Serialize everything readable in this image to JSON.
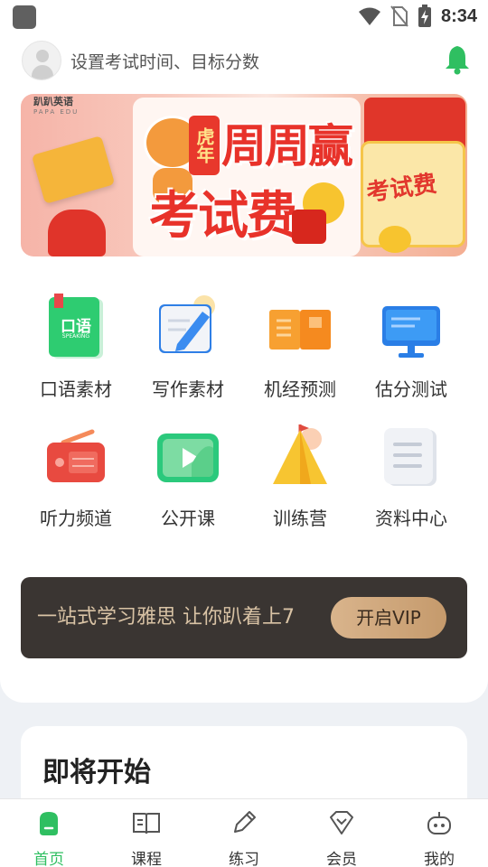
{
  "status_bar": {
    "time": "8:34"
  },
  "header": {
    "exam_prompt": "设置考试时间、目标分数"
  },
  "banner": {
    "logo_text": "趴趴英语",
    "logo_sub": "PAPA EDU",
    "tag": "虎年",
    "title_line1": "周周赢",
    "title_line2": "考试费",
    "side_text": "考试费"
  },
  "grid": {
    "items": [
      {
        "label": "口语素材",
        "icon": "speaking-book-icon"
      },
      {
        "label": "写作素材",
        "icon": "writing-pen-icon"
      },
      {
        "label": "机经预测",
        "icon": "open-book-icon"
      },
      {
        "label": "估分测试",
        "icon": "monitor-icon"
      },
      {
        "label": "听力频道",
        "icon": "radio-icon"
      },
      {
        "label": "公开课",
        "icon": "video-play-icon"
      },
      {
        "label": "训练营",
        "icon": "camp-tent-icon"
      },
      {
        "label": "资料中心",
        "icon": "document-icon"
      }
    ],
    "speaking_icon_text": "口语",
    "speaking_icon_sub": "SPEAKING"
  },
  "vip": {
    "slogan": "一站式学习雅思 让你趴着上7",
    "button": "开启VIP"
  },
  "upcoming": {
    "title": "即将开始"
  },
  "tabbar": {
    "tabs": [
      {
        "label": "首页",
        "icon": "home-icon",
        "active": true
      },
      {
        "label": "课程",
        "icon": "book-open-icon",
        "active": false
      },
      {
        "label": "练习",
        "icon": "pencil-icon",
        "active": false
      },
      {
        "label": "会员",
        "icon": "diamond-icon",
        "active": false
      },
      {
        "label": "我的",
        "icon": "profile-robot-icon",
        "active": false
      }
    ]
  },
  "colors": {
    "accent": "#2fbf61",
    "vip_bg": "#3a3532",
    "vip_gold": "#d9c3a5"
  }
}
